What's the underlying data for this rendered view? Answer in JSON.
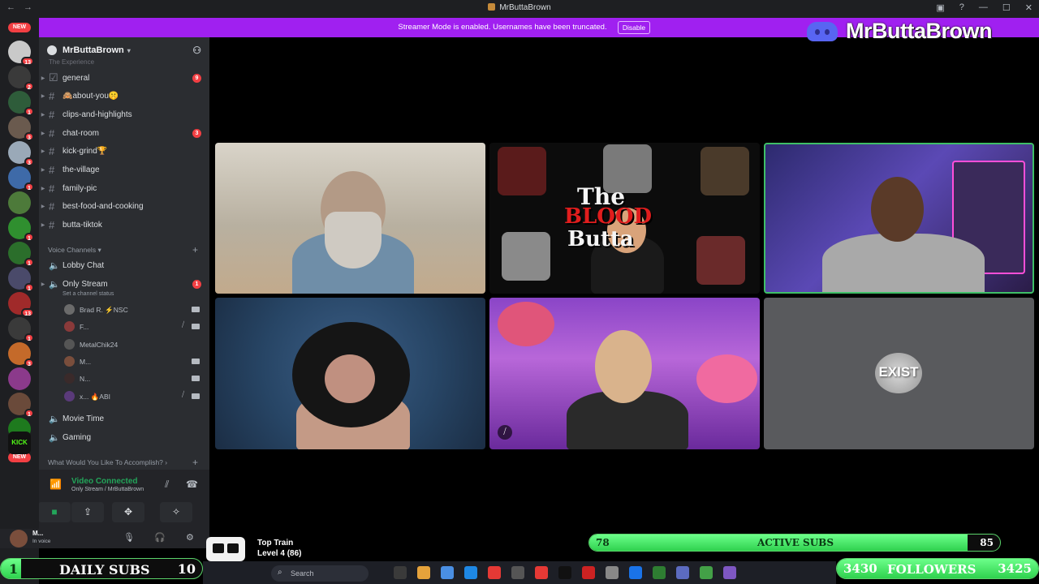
{
  "titlebar": {
    "title": "MrButtaBrown",
    "back_icon": "←",
    "forward_icon": "→",
    "inbox_icon": "▣",
    "help_icon": "?",
    "min_icon": "—",
    "max_icon": "☐",
    "close_icon": "✕"
  },
  "rail": {
    "new_top": "NEW",
    "new_bottom": "NEW",
    "servers": [
      {
        "color": "#c9c9c9",
        "badge": "13"
      },
      {
        "color": "#3a3a3a",
        "badge": "2"
      },
      {
        "color": "#2e5c3a",
        "badge": "1"
      },
      {
        "color": "#6a5a4e",
        "badge": "3"
      },
      {
        "color": "#9aa9b8",
        "badge": "3"
      },
      {
        "color": "#3e6aa8",
        "badge": "1"
      },
      {
        "color": "#4d7a3a",
        "badge": ""
      },
      {
        "color": "#2f8f2f",
        "badge": "1"
      },
      {
        "color": "#2b6e2b",
        "badge": "1"
      },
      {
        "color": "#4a4a6a",
        "badge": "1"
      },
      {
        "color": "#a02a2a",
        "badge": "13"
      },
      {
        "color": "#3a3a3a",
        "badge": "1"
      },
      {
        "color": "#c46a2a",
        "badge": "3"
      },
      {
        "color": "#8b3a8b",
        "badge": ""
      },
      {
        "color": "#6a4a3a",
        "badge": "1"
      },
      {
        "color": "#1e7a1e",
        "badge": ""
      }
    ],
    "kick_label": "KICK"
  },
  "banner": {
    "text": "Streamer Mode is enabled. Usernames have been truncated.",
    "disable": "Disable",
    "brand_name": "MrButtaBrown"
  },
  "sidebar": {
    "server_name": "MrButtaBrown",
    "faded_category": "The Experience",
    "channels": [
      {
        "label": "general",
        "count": "9",
        "icon": "☑"
      },
      {
        "label": "🙈about-you🤫",
        "count": "",
        "icon": "#"
      },
      {
        "label": "clips-and-highlights",
        "count": "",
        "icon": "#"
      },
      {
        "label": "chat-room",
        "count": "3",
        "icon": "#"
      },
      {
        "label": "kick-grind🏆",
        "count": "",
        "icon": "#"
      },
      {
        "label": "the-village",
        "count": "",
        "icon": "#"
      },
      {
        "label": "family-pic",
        "count": "",
        "icon": "#"
      },
      {
        "label": "best-food-and-cooking",
        "count": "",
        "icon": "#"
      },
      {
        "label": "butta-tiktok",
        "count": "",
        "icon": "#"
      }
    ],
    "voice_category": "Voice Channels",
    "voice_channels": [
      {
        "label": "Lobby Chat",
        "count": ""
      },
      {
        "label": "Only Stream",
        "count": "1"
      }
    ],
    "channel_status": "Set a channel status",
    "voice_users": [
      {
        "name": "Brad R. ⚡NSC",
        "color": "#6b6b6b",
        "cam": true,
        "muted": false
      },
      {
        "name": "F...",
        "color": "#8a3a3a",
        "cam": false,
        "muted": true
      },
      {
        "name": "MetalChik24",
        "color": "#555",
        "cam": false,
        "muted": false
      },
      {
        "name": "M...",
        "color": "#7a4e3c",
        "cam": true,
        "muted": false
      },
      {
        "name": "N...",
        "color": "#3a2a2a",
        "cam": true,
        "muted": false
      },
      {
        "name": "x... 🔥ABI",
        "color": "#5a3a7a",
        "cam": false,
        "muted": true
      }
    ],
    "more_voice": [
      "Movie Time",
      "Gaming"
    ],
    "bottom_category": "What Would You Like To Accomplish?",
    "voice_panel": {
      "connected": "Video Connected",
      "sub": "Only Stream / MrButtaBrown"
    },
    "user": {
      "name": "M...",
      "status": "In voice"
    }
  },
  "video": {
    "tile2_title1": "The",
    "tile2_title2": "BLOOD",
    "tile2_title3": "Butta",
    "tile6_logo": "EXIST"
  },
  "overlay": {
    "active_subs": {
      "left": "78",
      "label": "ACTIVE SUBS",
      "right": "85",
      "fill": 0.92
    },
    "daily_subs": {
      "left": "1",
      "label": "DAILY SUBS",
      "right": "10",
      "fill": 0.1
    },
    "followers": {
      "left": "3430",
      "label": "FOLLOWERS",
      "right": "3425",
      "fill": 1.0
    },
    "train": {
      "title": "Top Train",
      "level": "Level 4 (86)"
    }
  },
  "taskbar": {
    "search": "Search"
  }
}
